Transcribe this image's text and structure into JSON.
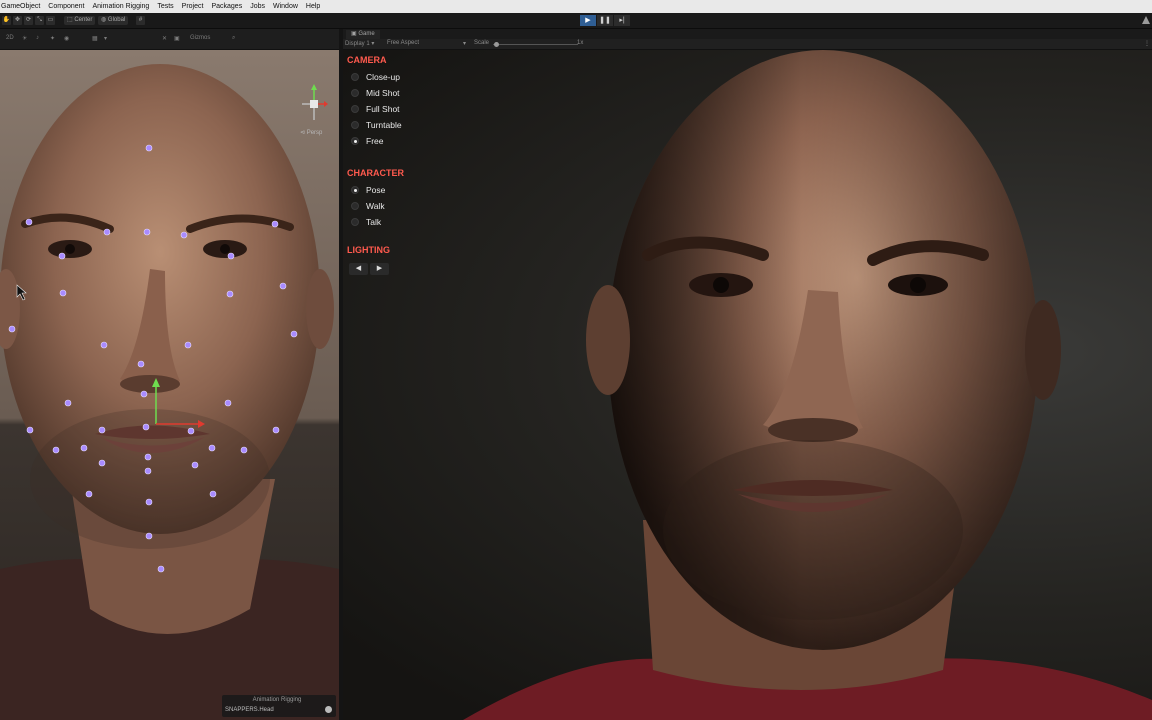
{
  "menubar": {
    "items": [
      "GameObject",
      "Component",
      "Animation Rigging",
      "Tests",
      "Project",
      "Packages",
      "Jobs",
      "Window",
      "Help"
    ]
  },
  "toolbar": {
    "pivot_label": "Center",
    "space_label": "Global",
    "play_active": true
  },
  "scene_view": {
    "mode_label": "2D",
    "gizmos_label": "Gizmos",
    "projection_label": "Persp",
    "footer_title": "Animation Rigging",
    "footer_selection": "SNAPPERS.Head"
  },
  "game_view": {
    "tab_label": "Game",
    "display_label": "Display 1",
    "aspect_label": "Free Aspect",
    "scale_label": "Scale",
    "scale_value": "1x"
  },
  "overlay_menu": {
    "camera": {
      "title": "CAMERA",
      "options": [
        {
          "label": "Close-up",
          "selected": false
        },
        {
          "label": "Mid Shot",
          "selected": false
        },
        {
          "label": "Full Shot",
          "selected": false
        },
        {
          "label": "Turntable",
          "selected": false
        },
        {
          "label": "Free",
          "selected": true
        }
      ]
    },
    "character": {
      "title": "CHARACTER",
      "options": [
        {
          "label": "Pose",
          "selected": true
        },
        {
          "label": "Walk",
          "selected": false
        },
        {
          "label": "Talk",
          "selected": false
        }
      ]
    },
    "lighting": {
      "title": "LIGHTING",
      "prev_icon": "arrow-left-icon",
      "next_icon": "arrow-right-icon"
    }
  },
  "colors": {
    "accent_red": "#ff5a4e",
    "play_active_blue": "#2f5e94",
    "control_point": "#a98bff",
    "shirt": "#6e1c24"
  }
}
